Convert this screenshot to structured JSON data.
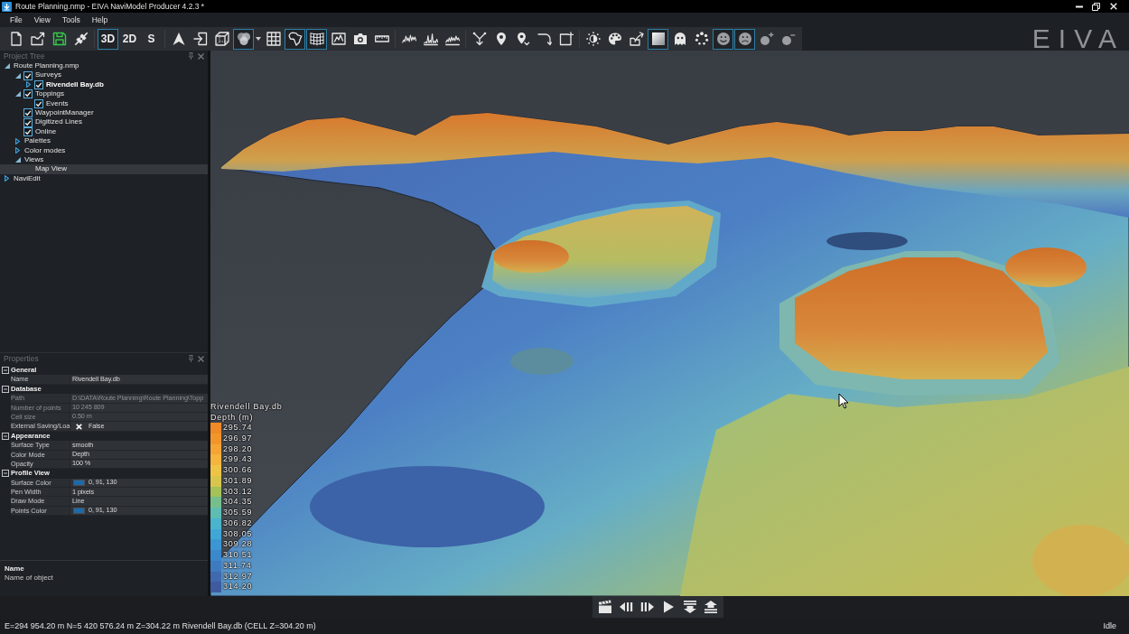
{
  "window": {
    "title": "Route Planning.nmp - EIVA NaviModel Producer 4.2.3 *"
  },
  "menu": [
    "File",
    "View",
    "Tools",
    "Help"
  ],
  "toolbar": {
    "groups": [
      [
        {
          "kind": "icon",
          "selected": false
        },
        {
          "kind": "icon",
          "selected": false
        },
        {
          "kind": "icon",
          "selected": false
        },
        {
          "kind": "icon",
          "selected": false
        }
      ],
      [
        {
          "kind": "text",
          "label": "3D",
          "selected": true
        },
        {
          "kind": "text",
          "label": "2D",
          "selected": false
        },
        {
          "kind": "text",
          "label": "S",
          "selected": false
        }
      ],
      [
        {
          "kind": "icon",
          "selected": false
        },
        {
          "kind": "icon",
          "selected": false
        },
        {
          "kind": "icon",
          "selected": false
        },
        {
          "kind": "icon",
          "selected": true,
          "dropdown": true
        },
        {
          "kind": "icon",
          "selected": false
        },
        {
          "kind": "icon",
          "selected": true
        },
        {
          "kind": "icon",
          "selected": true
        },
        {
          "kind": "icon",
          "selected": false
        },
        {
          "kind": "icon",
          "selected": false
        },
        {
          "kind": "icon",
          "selected": false
        }
      ],
      [
        {
          "kind": "icon",
          "selected": false
        },
        {
          "kind": "icon",
          "selected": false
        },
        {
          "kind": "icon",
          "selected": false
        }
      ],
      [
        {
          "kind": "icon",
          "selected": false
        },
        {
          "kind": "icon",
          "selected": false
        },
        {
          "kind": "icon",
          "selected": false
        },
        {
          "kind": "icon",
          "selected": false
        },
        {
          "kind": "icon",
          "selected": false
        }
      ],
      [
        {
          "kind": "icon",
          "selected": false
        },
        {
          "kind": "icon",
          "selected": false
        },
        {
          "kind": "icon",
          "selected": false
        },
        {
          "kind": "icon",
          "selected": true
        },
        {
          "kind": "icon",
          "selected": false
        },
        {
          "kind": "icon",
          "selected": false
        },
        {
          "kind": "icon",
          "selected": true
        },
        {
          "kind": "icon",
          "selected": true
        },
        {
          "kind": "icon",
          "selected": false
        },
        {
          "kind": "icon",
          "selected": false
        }
      ]
    ],
    "logo": "EIVA"
  },
  "project_tree": {
    "title": "Project Tree",
    "items": [
      {
        "label": "Route Planning.nmp",
        "expanded": true,
        "selected": false,
        "children": [
          {
            "label": "Surveys",
            "checked": true,
            "expanded": true,
            "selected": false,
            "children": [
              {
                "label": "Rivendell Bay.db",
                "checked": true,
                "expanded": false,
                "active": true,
                "selected": false
              }
            ]
          },
          {
            "label": "Toppings",
            "checked": true,
            "expanded": true,
            "selected": false,
            "children": [
              {
                "label": "Events",
                "checked": true,
                "selected": false
              }
            ]
          },
          {
            "label": "WaypointManager",
            "checked": true,
            "selected": false
          },
          {
            "label": "Digitized Lines",
            "checked": true,
            "selected": false
          },
          {
            "label": "Online",
            "checked": true,
            "selected": false
          },
          {
            "label": "Palettes",
            "expanded": false,
            "selected": false
          },
          {
            "label": "Color modes",
            "expanded": false,
            "selected": false
          },
          {
            "label": "Views",
            "expanded": true,
            "selected": false,
            "children": [
              {
                "label": "Map View",
                "selected": true
              }
            ]
          }
        ]
      },
      {
        "label": "NaviEdit",
        "expanded": false,
        "selected": false
      }
    ]
  },
  "properties": {
    "title": "Properties",
    "categories": [
      {
        "label": "General",
        "expanded": true,
        "rows": [
          {
            "name": "Name",
            "kind": "text",
            "value": "Rivendell Bay.db",
            "disabled": false
          }
        ]
      },
      {
        "label": "Database",
        "expanded": true,
        "rows": [
          {
            "name": "Path",
            "kind": "text",
            "value": "D:\\DATA\\Route Planning\\Route Planning\\Topp",
            "disabled": true
          },
          {
            "name": "Number of points",
            "kind": "text",
            "value": "10 245 809",
            "disabled": true
          },
          {
            "name": "Cell size",
            "kind": "text",
            "value": "0.50 m",
            "disabled": true
          },
          {
            "name": "External Saving/Loa",
            "kind": "bool",
            "checked": false,
            "value": "False",
            "disabled": false
          }
        ]
      },
      {
        "label": "Appearance",
        "expanded": true,
        "rows": [
          {
            "name": "Surface Type",
            "kind": "text",
            "value": "smooth",
            "disabled": false
          },
          {
            "name": "Color Mode",
            "kind": "text",
            "value": "Depth",
            "disabled": false
          },
          {
            "name": "Opacity",
            "kind": "text",
            "value": "100 %",
            "disabled": false
          }
        ]
      },
      {
        "label": "Profile View",
        "expanded": true,
        "rows": [
          {
            "name": "Surface Color",
            "kind": "color",
            "color": "#1d6aa8",
            "value": "0, 91, 130",
            "disabled": false
          },
          {
            "name": "Pen Width",
            "kind": "text",
            "value": "1 pixels",
            "disabled": false
          },
          {
            "name": "Draw Mode",
            "kind": "text",
            "value": "Line",
            "disabled": false
          },
          {
            "name": "Points Color",
            "kind": "color",
            "color": "#1d6aa8",
            "value": "0, 91, 130",
            "disabled": false
          }
        ]
      }
    ],
    "description": {
      "title": "Name",
      "text": "Name of object"
    }
  },
  "legend": {
    "title": "Rivendell Bay.db",
    "unit": "Depth (m)",
    "items": [
      {
        "label": "295.74",
        "color": "#ef8a26"
      },
      {
        "label": "296.97",
        "color": "#f2962c"
      },
      {
        "label": "298.20",
        "color": "#f4a535"
      },
      {
        "label": "299.43",
        "color": "#f4b43e"
      },
      {
        "label": "300.66",
        "color": "#efc446"
      },
      {
        "label": "301.89",
        "color": "#d8c54c"
      },
      {
        "label": "303.12",
        "color": "#a4c257"
      },
      {
        "label": "304.35",
        "color": "#76bf8c"
      },
      {
        "label": "305.59",
        "color": "#5dbdb2"
      },
      {
        "label": "306.82",
        "color": "#4ab4cd"
      },
      {
        "label": "308.05",
        "color": "#40a6d6"
      },
      {
        "label": "309.28",
        "color": "#3b97d4"
      },
      {
        "label": "310.51",
        "color": "#3b88cc"
      },
      {
        "label": "311.74",
        "color": "#3e7ac0"
      },
      {
        "label": "312.97",
        "color": "#4069ae"
      },
      {
        "label": "314.20",
        "color": "#3f5b9f"
      }
    ]
  },
  "status_bar": {
    "text": "E=294 954.20 m N=5 420 576.24 m Z=304.22 m Rivendell Bay.db (CELL Z=304.20 m)",
    "state": "Idle"
  }
}
